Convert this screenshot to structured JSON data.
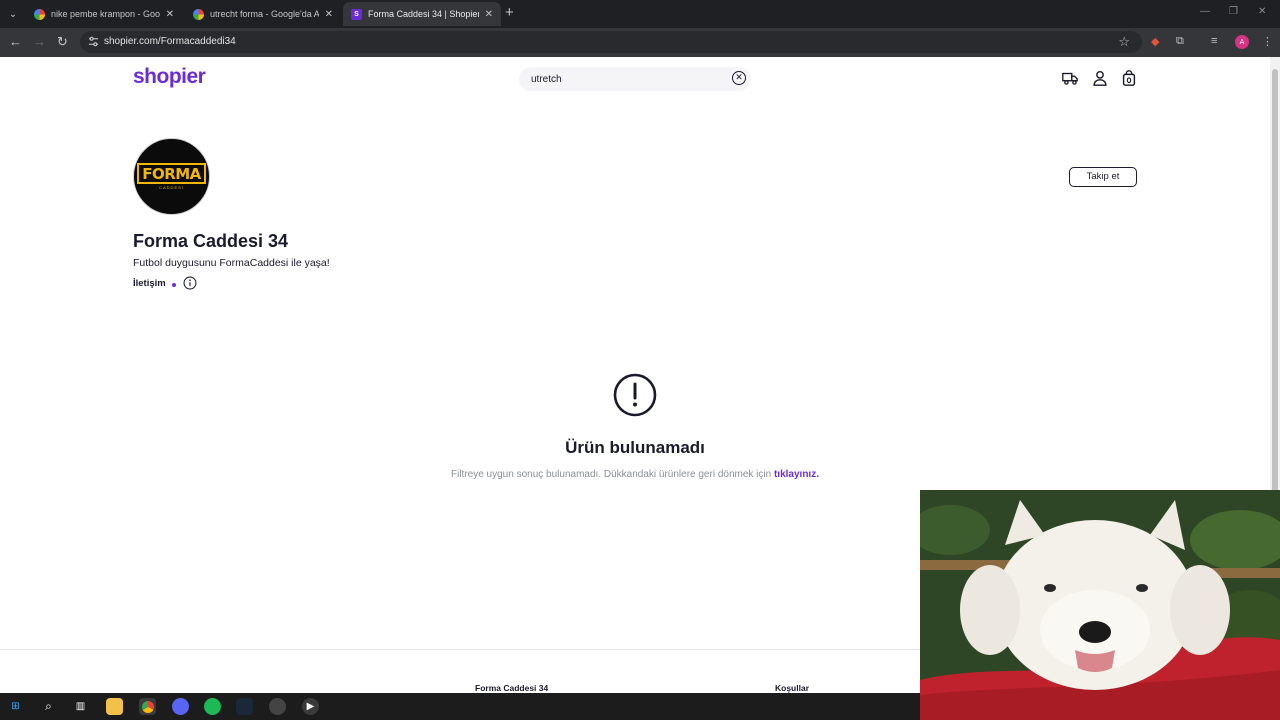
{
  "browser": {
    "tabs": [
      {
        "title": "nike pembe krampon - Google",
        "favicon": "google-icon",
        "active": false
      },
      {
        "title": "utrecht forma - Google'da Ara",
        "favicon": "google-icon",
        "active": false
      },
      {
        "title": "Forma Caddesi 34 | Shopier",
        "favicon": "shopier-icon",
        "favicon_letter": "S",
        "active": true
      }
    ],
    "new_tab": "+",
    "url": "shopier.com/Formacaddedi34",
    "profile_initial": "A"
  },
  "header": {
    "logo": "shopier",
    "search_value": "utretch"
  },
  "store": {
    "avatar_text": "FORMA",
    "avatar_subtext": "CADDESİ",
    "name": "Forma Caddesi 34",
    "description": "Futbol duygusunu FormaCaddesi ile yaşa!",
    "contact_label": "İletişim",
    "follow_label": "Takip et"
  },
  "empty_state": {
    "title": "Ürün bulunamadı",
    "text": "Filtreye uygun sonuç bulunamadı. Dükkandaki ürünlere geri dönmek için",
    "link": "tıklayınız."
  },
  "footer": {
    "col1_title": "Forma Caddesi 34",
    "col2_title": "Koşullar"
  },
  "colors": {
    "brand": "#6c2bd9",
    "text": "#1a1a2e",
    "muted": "#8a8f98",
    "avatar_accent": "#f2b705"
  }
}
